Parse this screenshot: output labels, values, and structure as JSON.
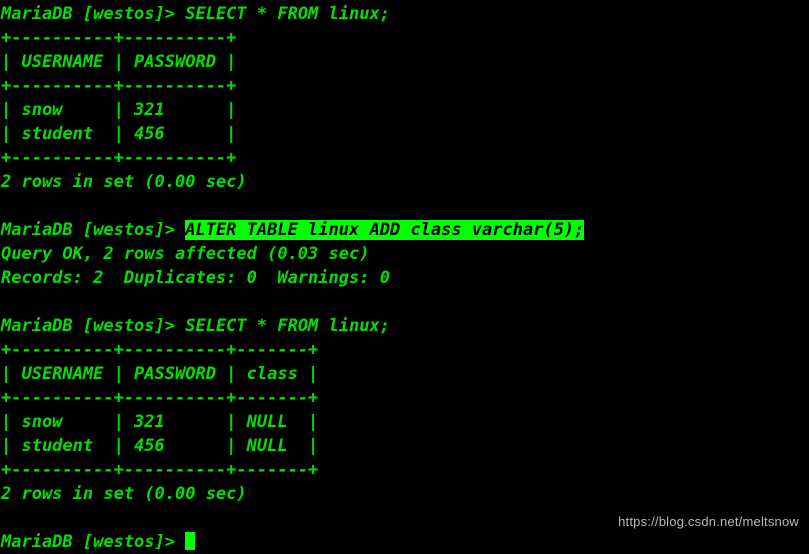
{
  "terminal": {
    "prompt": "MariaDB [westos]> ",
    "colors": {
      "background": "#000000",
      "foreground": "#00e000",
      "highlight_background": "#00ff00",
      "highlight_foreground": "#000000",
      "cursor": "#00ff00",
      "watermark": "#b9b9b9"
    },
    "lines": [
      {
        "type": "command",
        "prompt": "MariaDB [westos]> ",
        "command": "SELECT * FROM linux;"
      },
      {
        "type": "output",
        "text": "+----------+----------+"
      },
      {
        "type": "output",
        "text": "| USERNAME | PASSWORD |"
      },
      {
        "type": "output",
        "text": "+----------+----------+"
      },
      {
        "type": "output",
        "text": "| snow     | 321      |"
      },
      {
        "type": "output",
        "text": "| student  | 456      |"
      },
      {
        "type": "output",
        "text": "+----------+----------+"
      },
      {
        "type": "output",
        "text": "2 rows in set (0.00 sec)"
      },
      {
        "type": "blank",
        "text": " "
      },
      {
        "type": "command",
        "prompt": "MariaDB [westos]> ",
        "command": "ALTER TABLE linux ADD class varchar(5);",
        "highlighted": true
      },
      {
        "type": "output",
        "text": "Query OK, 2 rows affected (0.03 sec)"
      },
      {
        "type": "output",
        "text": "Records: 2  Duplicates: 0  Warnings: 0"
      },
      {
        "type": "blank",
        "text": " "
      },
      {
        "type": "command",
        "prompt": "MariaDB [westos]> ",
        "command": "SELECT * FROM linux;"
      },
      {
        "type": "output",
        "text": "+----------+----------+-------+"
      },
      {
        "type": "output",
        "text": "| USERNAME | PASSWORD | class |"
      },
      {
        "type": "output",
        "text": "+----------+----------+-------+"
      },
      {
        "type": "output",
        "text": "| snow     | 321      | NULL  |"
      },
      {
        "type": "output",
        "text": "| student  | 456      | NULL  |"
      },
      {
        "type": "output",
        "text": "+----------+----------+-------+"
      },
      {
        "type": "output",
        "text": "2 rows in set (0.00 sec)"
      },
      {
        "type": "blank",
        "text": " "
      },
      {
        "type": "prompt-cursor",
        "prompt": "MariaDB [westos]> "
      }
    ]
  },
  "watermark": {
    "text": "https://blog.csdn.net/meltsnow"
  }
}
